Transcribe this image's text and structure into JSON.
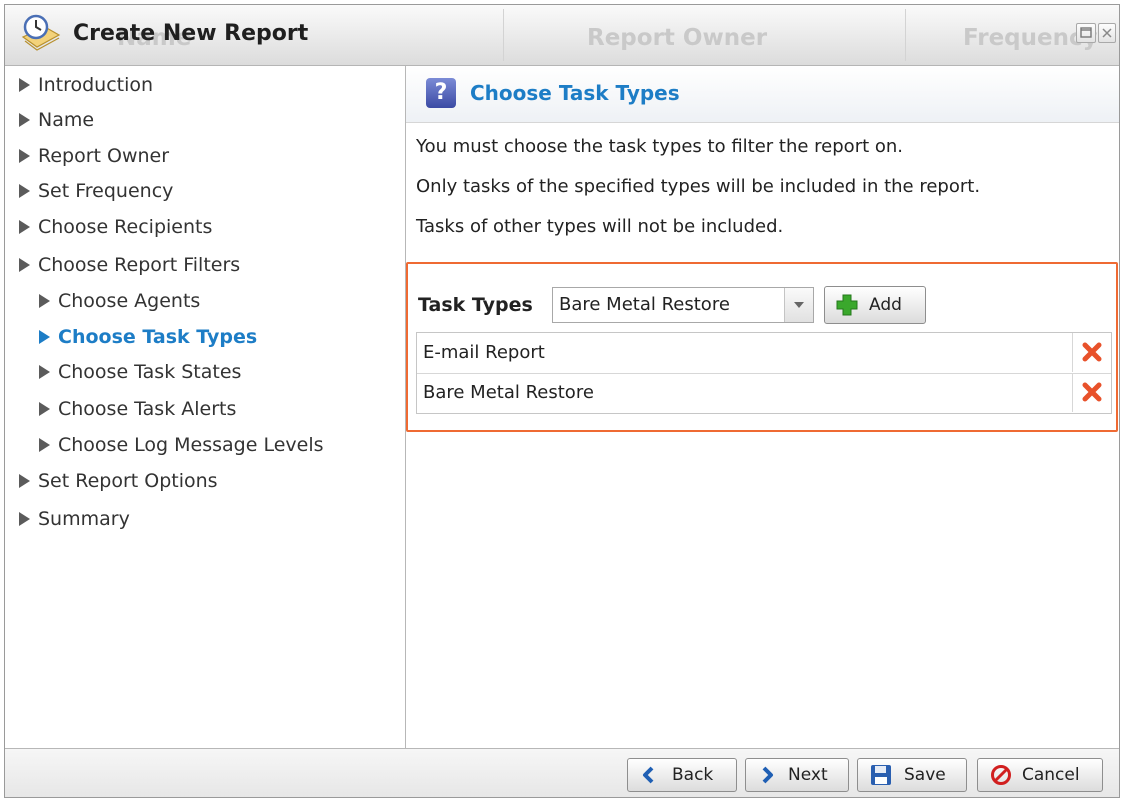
{
  "window": {
    "title": "Create New Report",
    "background_tabs": [
      "Name",
      "Report Owner",
      "Frequency"
    ]
  },
  "sidebar": {
    "items": [
      {
        "label": "Introduction",
        "level": 0,
        "active": false
      },
      {
        "label": "Name",
        "level": 0,
        "active": false
      },
      {
        "label": "Report Owner",
        "level": 0,
        "active": false
      },
      {
        "label": "Set Frequency",
        "level": 0,
        "active": false
      },
      {
        "label": "Choose Recipients",
        "level": 0,
        "active": false
      },
      {
        "label": "Choose Report Filters",
        "level": 0,
        "active": false
      },
      {
        "label": "Choose Agents",
        "level": 1,
        "active": false
      },
      {
        "label": "Choose Task Types",
        "level": 1,
        "active": true
      },
      {
        "label": "Choose Task States",
        "level": 1,
        "active": false
      },
      {
        "label": "Choose Task Alerts",
        "level": 1,
        "active": false
      },
      {
        "label": "Choose Log Message Levels",
        "level": 1,
        "active": false
      },
      {
        "label": "Set Report Options",
        "level": 0,
        "active": false
      },
      {
        "label": "Summary",
        "level": 0,
        "active": false
      }
    ]
  },
  "main": {
    "title": "Choose Task Types",
    "help_icon_text": "?",
    "paragraphs": [
      "You must choose the task types to filter the report on.",
      "Only tasks of the specified types will be included in the report.",
      "Tasks of other types will not be included."
    ],
    "task_types": {
      "label": "Task Types",
      "selected": "Bare Metal Restore",
      "add_label": "Add",
      "rows": [
        "E-mail Report",
        "Bare Metal Restore"
      ]
    }
  },
  "footer": {
    "back_label": "Back",
    "next_label": "Next",
    "save_label": "Save",
    "cancel_label": "Cancel"
  },
  "colors": {
    "accent": "#1d7dc6",
    "highlight_border": "#ef6a33",
    "delete_icon": "#e8512a",
    "add_icon": "#3aa82c"
  }
}
